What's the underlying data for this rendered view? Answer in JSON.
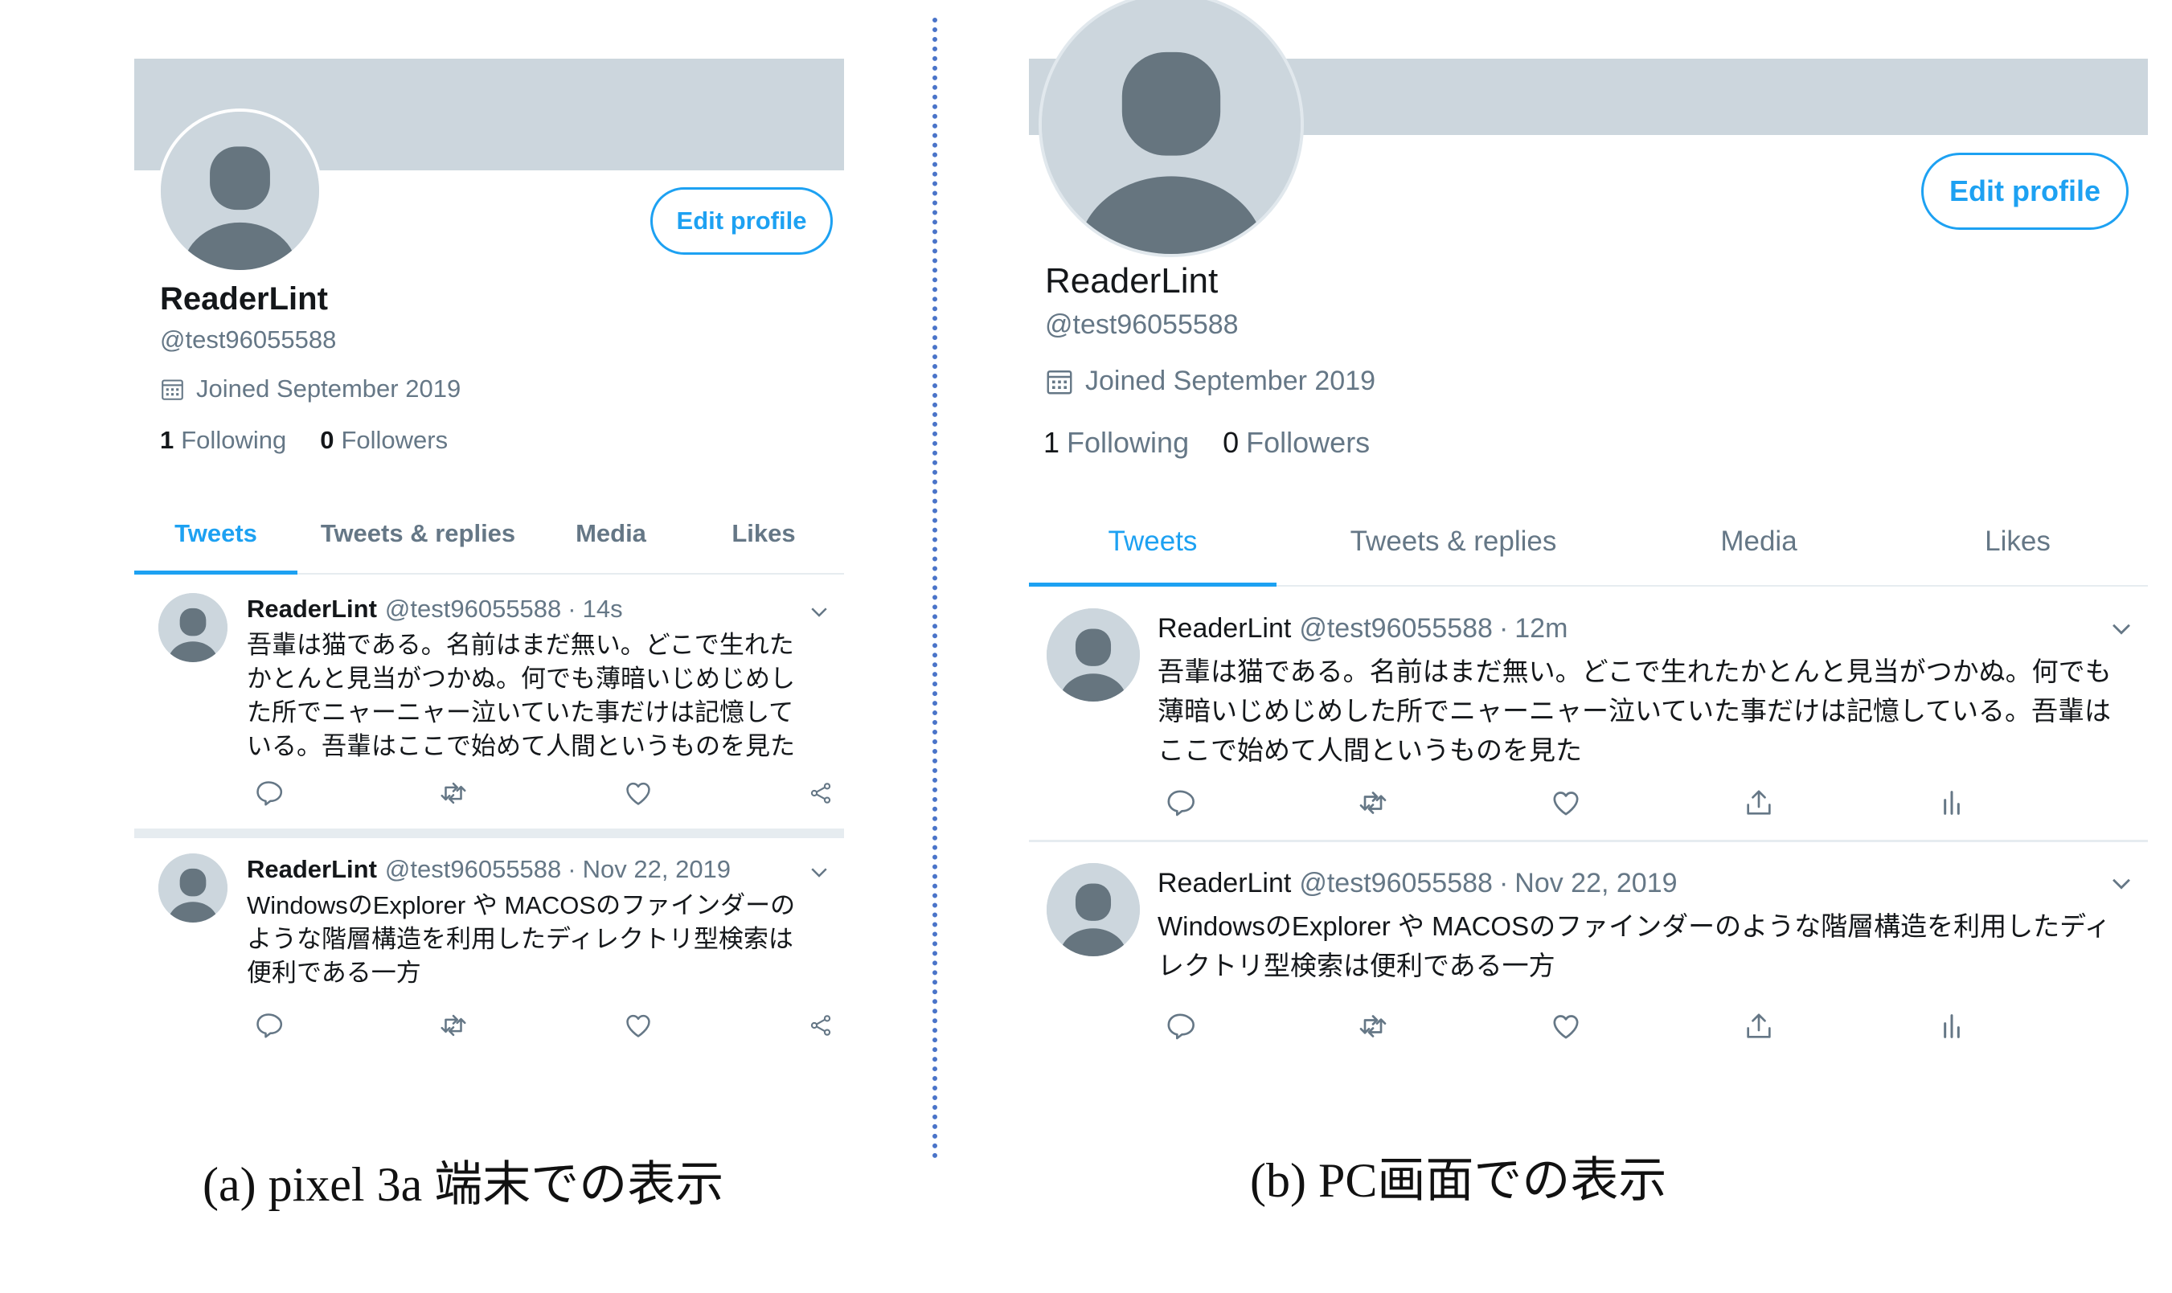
{
  "panels": {
    "mobile": {
      "edit_label": "Edit profile",
      "name": "ReaderLint",
      "handle": "@test96055588",
      "joined": "Joined September 2019",
      "following_count": "1",
      "following_label": "Following",
      "followers_count": "0",
      "followers_label": "Followers",
      "tabs": [
        "Tweets",
        "Tweets & replies",
        "Media",
        "Likes"
      ],
      "tweets": [
        {
          "name": "ReaderLint",
          "handle": "@test96055588",
          "dot": "·",
          "time": "14s",
          "text": "吾輩は猫である。名前はまだ無い。どこで生れたかとんと見当がつかぬ。何でも薄暗いじめじめした所でニャーニャー泣いていた事だけは記憶している。吾輩はここで始めて人間というものを見た"
        },
        {
          "name": "ReaderLint",
          "handle": "@test96055588",
          "dot": "·",
          "time": "Nov 22, 2019",
          "text": "WindowsのExplorer や MACOSのファインダーのような階層構造を利用したディレクトリ型検索は便利である一方"
        }
      ],
      "action_icons": [
        "reply-icon",
        "retweet-icon",
        "like-icon",
        "share-icon"
      ]
    },
    "pc": {
      "edit_label": "Edit profile",
      "name": "ReaderLint",
      "handle": "@test96055588",
      "joined": "Joined September 2019",
      "following_count": "1",
      "following_label": "Following",
      "followers_count": "0",
      "followers_label": "Followers",
      "tabs": [
        "Tweets",
        "Tweets & replies",
        "Media",
        "Likes"
      ],
      "tweets": [
        {
          "name": "ReaderLint",
          "handle": "@test96055588",
          "dot": "·",
          "time": "12m",
          "text": "吾輩は猫である。名前はまだ無い。どこで生れたかとんと見当がつかぬ。何でも薄暗いじめじめした所でニャーニャー泣いていた事だけは記憶している。吾輩はここで始めて人間というものを見た"
        },
        {
          "name": "ReaderLint",
          "handle": "@test96055588",
          "dot": "·",
          "time": "Nov 22, 2019",
          "text": "WindowsのExplorer や MACOSのファインダーのような階層構造を利用したディレクトリ型検索は便利である一方"
        }
      ],
      "action_icons": [
        "reply-icon",
        "retweet-icon",
        "like-icon",
        "upload-icon",
        "analytics-icon"
      ]
    }
  },
  "captions": {
    "a": "(a) pixel 3a 端末での表示",
    "b": "(b) PC画面での表示"
  },
  "colors": {
    "accent": "#1da1f2",
    "banner": "#ccd6dd",
    "muted": "#657786",
    "divider": "#4a74c9"
  }
}
